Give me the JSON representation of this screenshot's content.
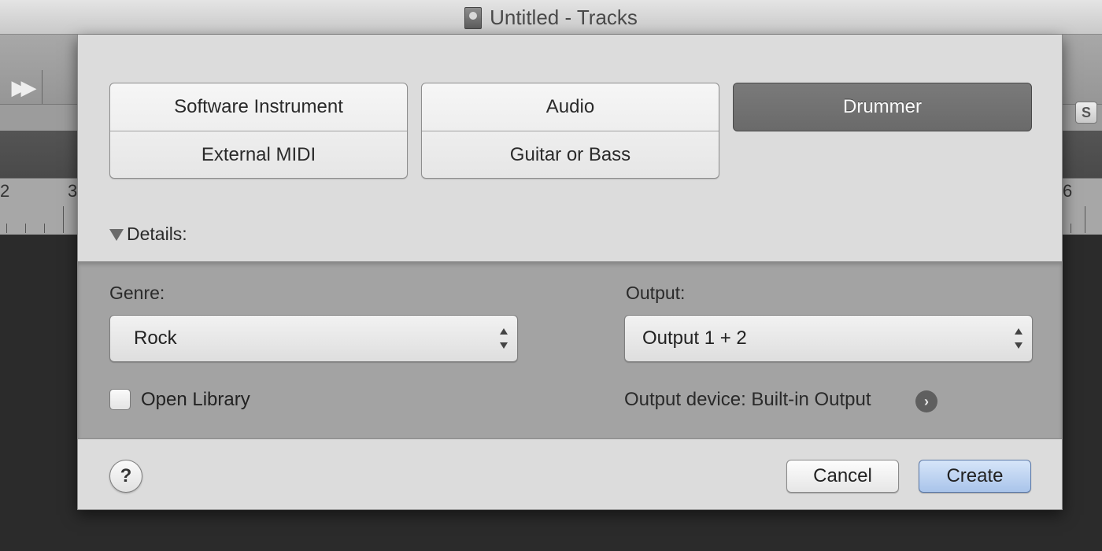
{
  "window": {
    "title": "Untitled - Tracks",
    "project_icon": "project-document-icon"
  },
  "background": {
    "toolbar": {
      "fast_forward_icon": "fast-forward-icon",
      "solo_label": "S"
    },
    "ruler": {
      "bar_numbers": [
        "2",
        "3",
        "6"
      ]
    }
  },
  "dialog": {
    "track_types": {
      "group1": [
        "Software Instrument",
        "External MIDI"
      ],
      "group2": [
        "Audio",
        "Guitar or Bass"
      ],
      "selected": "Drummer"
    },
    "details": {
      "toggle_label": "Details:",
      "expanded": true,
      "genre_label": "Genre:",
      "genre_value": "Rock",
      "output_label": "Output:",
      "output_value": "Output 1 + 2",
      "open_library_label": "Open Library",
      "open_library_checked": false,
      "output_device_text": "Output device: Built-in Output"
    },
    "footer": {
      "help_label": "?",
      "cancel_label": "Cancel",
      "create_label": "Create"
    }
  },
  "colors": {
    "selected_segment": "#6f6f6f",
    "default_button": "#a9c4ea",
    "details_panel": "#a3a3a3"
  }
}
